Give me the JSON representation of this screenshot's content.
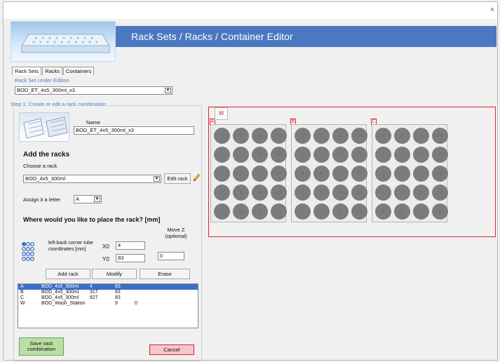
{
  "window": {
    "title": "Rack Sets / Racks / Container Editor",
    "close_glyph": "×"
  },
  "tabs": [
    "Rack Sets",
    "Racks",
    "Containers"
  ],
  "rack_set": {
    "label": "Rack Set Under Edition",
    "value": "BOD_ET_4x5_300ml_x3"
  },
  "step1": {
    "legend": "Step 1: Create or edit a rack combination",
    "name_label": "Name",
    "name_value": "BOD_ET_4x5_300ml_x3"
  },
  "add_racks": {
    "heading": "Add the racks",
    "choose_label": "Choose a rack",
    "rack_value": "BOD_4x5_300ml",
    "edit_rack_button": "Edit rack",
    "edit_icon": "pencil-icon",
    "assign_label": "Assign it a letter",
    "letter_value": "A"
  },
  "placement": {
    "heading": "Where would you like to place the rack? [mm]",
    "corner_text": "left-back corner tube coordinates [mm]",
    "x0_label": "X0",
    "x0_value": "4",
    "y0_label": "Y0",
    "y0_value": "83",
    "movez_label": "Move Z (optional)",
    "movez_value": "0"
  },
  "buttons": {
    "add_rack": "Add rack",
    "modify": "Modify",
    "erase": "Erase",
    "save": "Save rack combination",
    "cancel": "Cancel"
  },
  "rack_list": [
    {
      "letter": "A",
      "name": "BOD_4x5_300ml",
      "x": "4",
      "y": "83",
      "z": "",
      "selected": true
    },
    {
      "letter": "B",
      "name": "BOD_4x5_300ml",
      "x": "317",
      "y": "83",
      "z": "",
      "selected": false
    },
    {
      "letter": "C",
      "name": "BOD_4x5_300ml",
      "x": "627",
      "y": "83",
      "z": "",
      "selected": false
    },
    {
      "letter": "W",
      "name": "BOD_Wash_Station",
      "x": "",
      "y": "9",
      "z": "0",
      "selected": false
    }
  ],
  "canvas": {
    "wash_label": "W",
    "racks": [
      {
        "letter": "A",
        "rows": 5,
        "cols": 4
      },
      {
        "letter": "B",
        "rows": 5,
        "cols": 4
      },
      {
        "letter": "C",
        "rows": 5,
        "cols": 4
      }
    ]
  },
  "colors": {
    "header_blue": "#4a79c1",
    "accent_red": "#d9242f",
    "tube_gray": "#7c7c7c",
    "tube_number": "#4b6cc9",
    "selection_blue": "#3a6fc7",
    "save_green": "#b9e0a4",
    "cancel_pink": "#f6c6cb"
  }
}
